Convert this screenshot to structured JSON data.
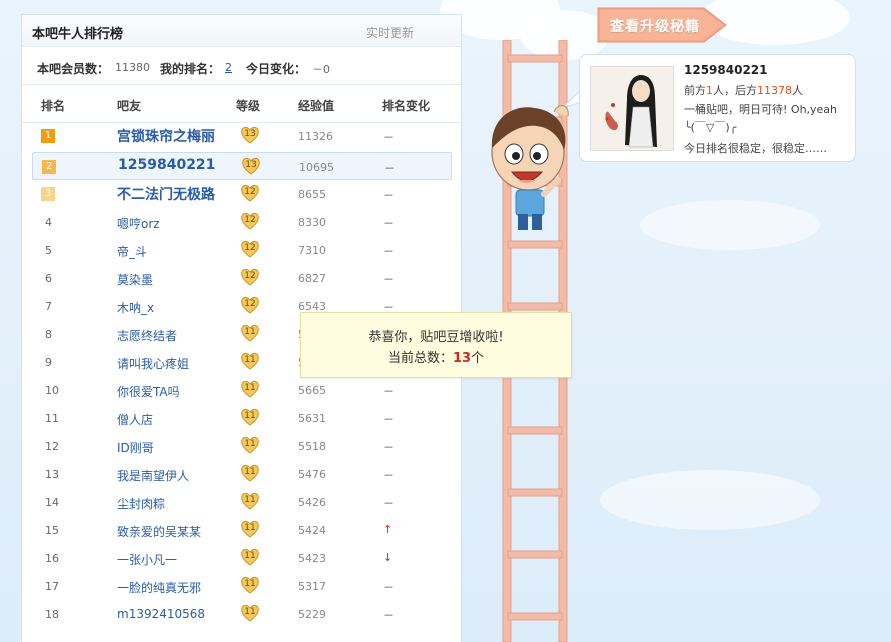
{
  "panel": {
    "title": "本吧牛人排行榜",
    "realtime": "实时更新"
  },
  "summary": {
    "members_label": "本吧会员数：",
    "members_value": "11380",
    "my_rank_label": "我的排名：",
    "my_rank_value": "2",
    "today_change_label": "今日变化：",
    "today_change_value": "－0"
  },
  "columns": {
    "rank": "排名",
    "friend": "吧友",
    "level": "等级",
    "exp": "经验值",
    "change": "排名变化"
  },
  "rows": [
    {
      "rank": "1",
      "name": "宫锁珠帘之梅丽",
      "level": "13",
      "exp": "11326",
      "change": "－"
    },
    {
      "rank": "2",
      "name": "1259840221",
      "level": "13",
      "exp": "10695",
      "change": "－"
    },
    {
      "rank": "3",
      "name": "不二法门无极路",
      "level": "12",
      "exp": "8655",
      "change": "－"
    },
    {
      "rank": "4",
      "name": "嗯哼orz",
      "level": "12",
      "exp": "8330",
      "change": "－"
    },
    {
      "rank": "5",
      "name": "帝_斗",
      "level": "12",
      "exp": "7310",
      "change": "－"
    },
    {
      "rank": "6",
      "name": "莫染墨",
      "level": "12",
      "exp": "6827",
      "change": "－"
    },
    {
      "rank": "7",
      "name": "木呐_x",
      "level": "12",
      "exp": "6543",
      "change": "－"
    },
    {
      "rank": "8",
      "name": "志愿终结者",
      "level": "11",
      "exp": "5",
      "change": ""
    },
    {
      "rank": "9",
      "name": "请叫我心疼姐",
      "level": "11",
      "exp": "5",
      "change": ""
    },
    {
      "rank": "10",
      "name": "你很爱TA吗",
      "level": "11",
      "exp": "5665",
      "change": "－"
    },
    {
      "rank": "11",
      "name": "僧人店",
      "level": "11",
      "exp": "5631",
      "change": "－"
    },
    {
      "rank": "12",
      "name": "ID刚哥",
      "level": "11",
      "exp": "5518",
      "change": "－"
    },
    {
      "rank": "13",
      "name": "我是南望伊人",
      "level": "11",
      "exp": "5476",
      "change": "－"
    },
    {
      "rank": "14",
      "name": "尘封肉粽",
      "level": "11",
      "exp": "5426",
      "change": "－"
    },
    {
      "rank": "15",
      "name": "致亲爱的吴某某",
      "level": "11",
      "exp": "5424",
      "change": "↑"
    },
    {
      "rank": "16",
      "name": "一张小凡一",
      "level": "11",
      "exp": "5423",
      "change": "↓"
    },
    {
      "rank": "17",
      "name": "一脸的纯真无邪",
      "level": "11",
      "exp": "5317",
      "change": "－"
    },
    {
      "rank": "18",
      "name": "m1392410568",
      "level": "11",
      "exp": "5229",
      "change": "－"
    }
  ],
  "upgrade": {
    "label": "查看升级秘籍"
  },
  "card": {
    "username": "1259840221",
    "ahead_prefix": "前方",
    "ahead_count": "1",
    "ahead_suffix": "人，后方",
    "behind_count": "11378",
    "behind_suffix": "人",
    "motto_line1": "一桶贴吧，明日可待! Oh,yeah",
    "motto_line2": "╰(￣▽￣)╭",
    "status": "今日排名很稳定，很稳定……"
  },
  "toast": {
    "line1": "恭喜你，贴吧豆增收啦!",
    "line2_prefix": "当前总数：",
    "count": "13",
    "line2_suffix": "个"
  },
  "colors": {
    "link": "#2a5da8",
    "gold1": "#f39c12",
    "gold2": "#f7b74a",
    "gold3": "#fbd28a",
    "ladder": "#f0b8a4",
    "accent": "#e0501a",
    "badge_fill": "#f6c75a"
  },
  "icons": {
    "level_badge": "heart-level-badge-icon",
    "up": "arrow-up-icon",
    "down": "arrow-down-icon"
  }
}
